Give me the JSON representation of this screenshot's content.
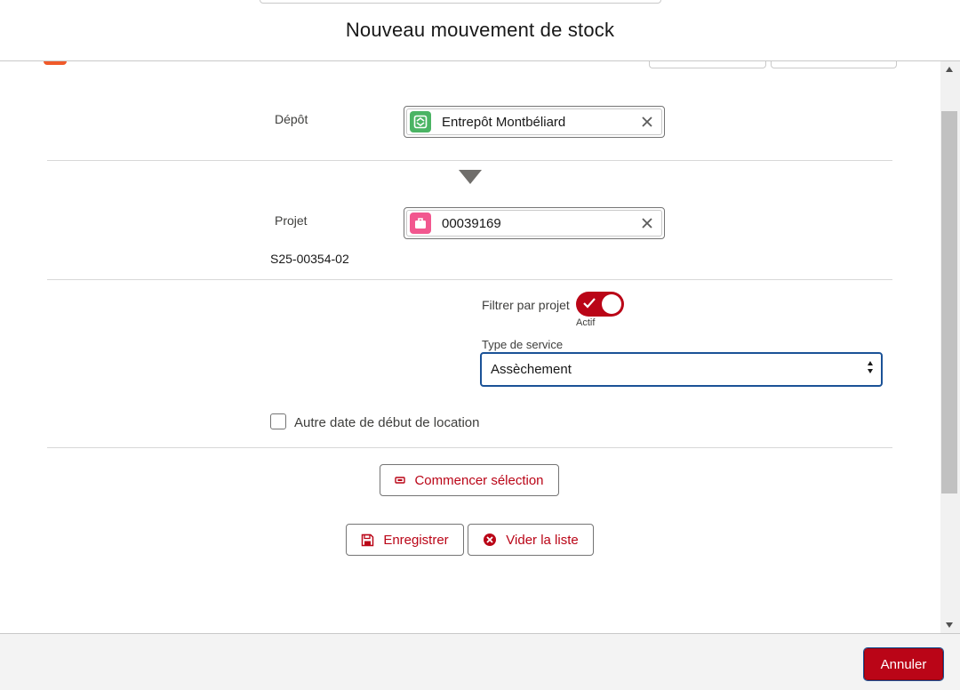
{
  "header": {
    "title": "Nouveau mouvement de stock"
  },
  "depot": {
    "label": "Dépôt",
    "value": "Entrepôt Montbéliard",
    "icon": "warehouse-icon",
    "icon_color": "#4bb464"
  },
  "projet": {
    "label": "Projet",
    "value": "00039169",
    "icon": "briefcase-icon",
    "icon_color": "#f2578f",
    "sub_value": "S25-00354-02"
  },
  "filter": {
    "label": "Filtrer par projet",
    "state_label": "Actif",
    "enabled": true
  },
  "service": {
    "label": "Type de service",
    "selected": "Assèchement"
  },
  "alt_date": {
    "label": "Autre date de début de location",
    "checked": false
  },
  "actions": {
    "start_label": "Commencer sélection",
    "save_label": "Enregistrer",
    "clear_label": "Vider la liste"
  },
  "footer": {
    "cancel_label": "Annuler"
  },
  "colors": {
    "accent": "#ba0517",
    "focus": "#1b5297"
  }
}
